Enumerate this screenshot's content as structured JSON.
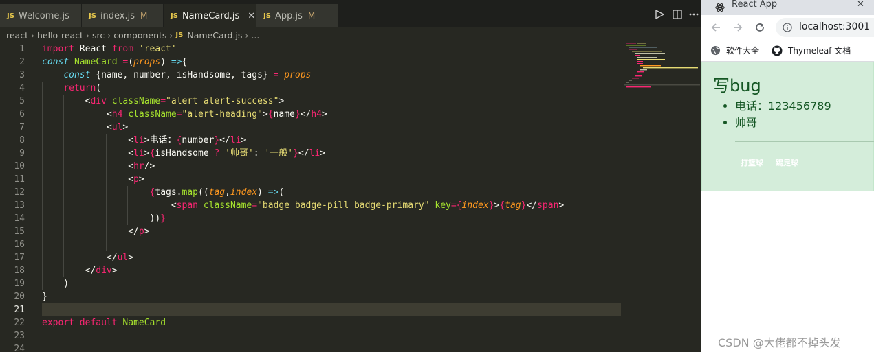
{
  "editor": {
    "tabs": [
      {
        "badge": "JS",
        "label": "Welcome.js",
        "modified": ""
      },
      {
        "badge": "JS",
        "label": "index.js",
        "modified": "M"
      },
      {
        "badge": "JS",
        "label": "NameCard.js",
        "modified": "",
        "close": "✕"
      },
      {
        "badge": "JS",
        "label": "App.js",
        "modified": "M"
      }
    ],
    "breadcrumb": [
      "react",
      "hello-react",
      "src",
      "components",
      "NameCard.js",
      "..."
    ],
    "breadcrumb_badge": "JS",
    "line_numbers": [
      "1",
      "2",
      "3",
      "4",
      "5",
      "6",
      "7",
      "8",
      "9",
      "10",
      "11",
      "12",
      "13",
      "14",
      "15",
      "16",
      "17",
      "18",
      "19",
      "20",
      "21",
      "22",
      "23",
      "24"
    ],
    "colors": {
      "keyword": "#f92672",
      "function": "#a6e22e",
      "string": "#e6db74",
      "param": "#fd971f",
      "storage": "#66d9ef",
      "background": "#272822"
    }
  },
  "browser": {
    "tab_title": "React App",
    "tab_close": "✕",
    "url": "localhost:3001",
    "bookmarks": [
      {
        "icon": "globe-icon",
        "label": "软件大全"
      },
      {
        "icon": "github-icon",
        "label": "Thymeleaf 文档"
      }
    ],
    "card": {
      "heading": "写bug",
      "items": [
        "电话：123456789",
        "帅哥"
      ],
      "tags": [
        "打篮球",
        "踢足球"
      ]
    },
    "alert_color": "#d4edda"
  },
  "watermark": "CSDN @大佬都不掉头发"
}
